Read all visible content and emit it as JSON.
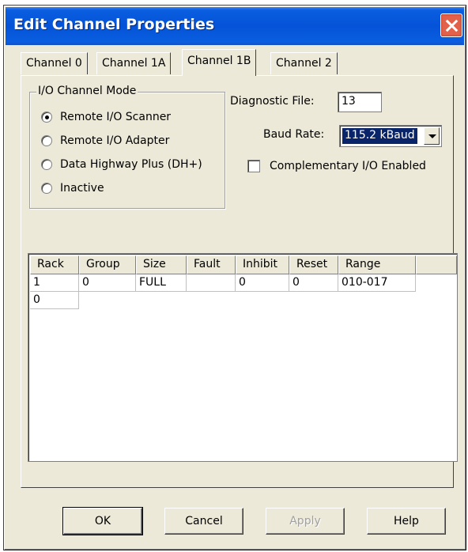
{
  "window": {
    "title": "Edit Channel Properties"
  },
  "tabs": [
    "Channel 0",
    "Channel 1A",
    "Channel 1B",
    "Channel 2"
  ],
  "active_tab": "Channel 1B",
  "io_mode": {
    "legend": "I/O Channel Mode",
    "options": [
      {
        "label": "Remote I/O Scanner",
        "checked": true
      },
      {
        "label": "Remote I/O Adapter",
        "checked": false
      },
      {
        "label": "Data Highway Plus (DH+)",
        "checked": false
      },
      {
        "label": "Inactive",
        "checked": false
      }
    ]
  },
  "diagnostic": {
    "label": "Diagnostic File:",
    "value": "13"
  },
  "baud": {
    "label": "Baud Rate:",
    "value": "115.2 kBaud"
  },
  "complementary": {
    "label": "Complementary I/O Enabled",
    "checked": false
  },
  "table": {
    "columns": [
      "Rack",
      "Group",
      "Size",
      "Fault",
      "Inhibit",
      "Reset",
      "Range"
    ],
    "rows": [
      [
        "1",
        "0",
        "FULL",
        "",
        "0",
        "0",
        "010-017"
      ],
      [
        "0"
      ]
    ]
  },
  "buttons": {
    "ok": "OK",
    "cancel": "Cancel",
    "apply": "Apply",
    "help": "Help"
  },
  "colors": {
    "titlebar": "#0553d8",
    "selection": "#0a246a",
    "close": "#e2614a"
  }
}
